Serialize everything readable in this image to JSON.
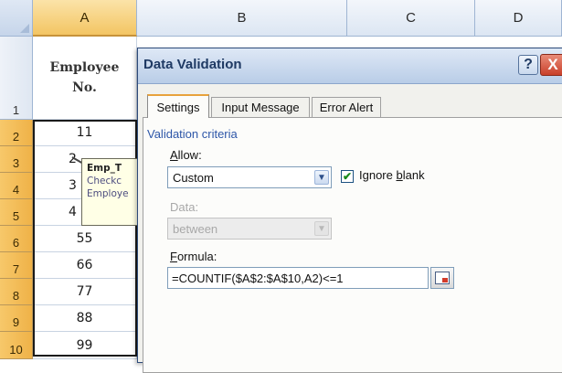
{
  "spreadsheet": {
    "columns": [
      "A",
      "B",
      "C",
      "D"
    ],
    "header_cell": "Employee No.",
    "row_numbers": [
      "1",
      "2",
      "3",
      "4",
      "5",
      "6",
      "7",
      "8",
      "9",
      "10"
    ],
    "values": [
      "11",
      "2",
      "3",
      "4",
      "55",
      "66",
      "77",
      "88",
      "99"
    ],
    "comment": {
      "title": "Emp_T",
      "line1": "Checkc",
      "line2": "Employe"
    }
  },
  "dialog": {
    "title": "Data Validation",
    "help_button": "?",
    "close_button": "X",
    "tabs": [
      "Settings",
      "Input Message",
      "Error Alert"
    ],
    "active_tab": "Settings",
    "group_label": "Validation criteria",
    "allow_label": "Allow:",
    "allow_value": "Custom",
    "ignore_blank_label": "Ignore blank",
    "ignore_blank_checked": true,
    "data_label": "Data:",
    "data_value": "between",
    "formula_label": "Formula:",
    "formula_value": "=COUNTIF($A$2:$A$10,A2)<=1"
  },
  "colors": {
    "active_header": "#f3c563",
    "title_text": "#1f3a64",
    "close_red": "#c9402a",
    "group_label_blue": "#2d56a8"
  }
}
